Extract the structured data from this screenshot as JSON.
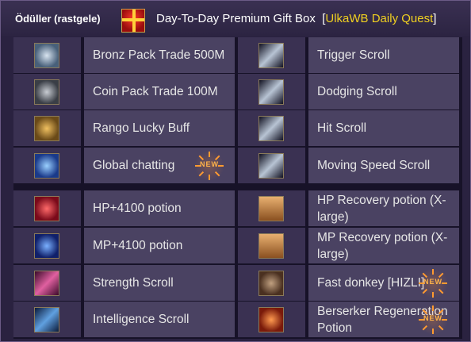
{
  "header": {
    "tag": "Ödüller (rastgele)",
    "title": "Day-To-Day Premium Gift Box",
    "quest_open": "[",
    "quest": "UlkaWB Daily Quest",
    "quest_close": "]"
  },
  "rewards": [
    {
      "left": {
        "name": "Bronz Pack Trade 500M",
        "icon": "coin-100m-icon"
      },
      "right": {
        "name": "Trigger Scroll",
        "icon": "scroll-icon"
      }
    },
    {
      "left": {
        "name": "Coin Pack Trade 100M",
        "icon": "coin-500m-icon"
      },
      "right": {
        "name": "Dodging Scroll",
        "icon": "scroll-icon"
      }
    },
    {
      "left": {
        "name": "Rango Lucky Buff",
        "icon": "medallion-icon"
      },
      "right": {
        "name": "Hit Scroll",
        "icon": "scroll-icon"
      }
    },
    {
      "left": {
        "name": "Global chatting",
        "icon": "globe-icon",
        "badge": "NEW"
      },
      "right": {
        "name": "Moving Speed Scroll",
        "icon": "scroll-icon"
      }
    },
    {
      "left": {
        "name": "HP+4100 potion",
        "icon": "red-potion-icon"
      },
      "right": {
        "name": "HP Recovery potion (X-large)",
        "icon": "chest-icon"
      }
    },
    {
      "left": {
        "name": "MP+4100 potion",
        "icon": "blue-potion-icon"
      },
      "right": {
        "name": "MP Recovery potion (X-large)",
        "icon": "chest-icon"
      }
    },
    {
      "left": {
        "name": "Strength Scroll",
        "icon": "pink-scroll-icon"
      },
      "right": {
        "name": "Fast donkey [HIZLI]",
        "icon": "donkey-icon",
        "badge": "NEW"
      }
    },
    {
      "left": {
        "name": "Intelligence Scroll",
        "icon": "blue-scroll-icon"
      },
      "right": {
        "name": "Berserker Regeneration Potion",
        "icon": "berserker-potion-icon",
        "badge": "NEW"
      }
    }
  ],
  "colors": {
    "quest_accent": "#f0d020",
    "badge": "#ffb34a"
  }
}
